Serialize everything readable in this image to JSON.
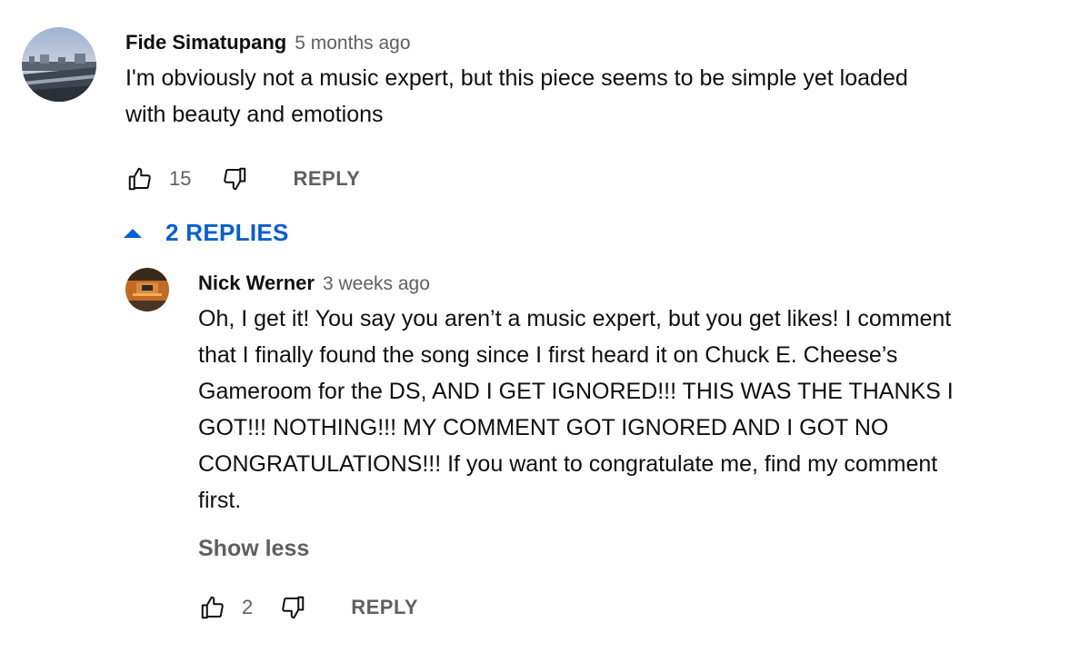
{
  "comment": {
    "author": "Fide Simatupang",
    "time": "5 months ago",
    "text_line1": "I'm obviously not a music expert, but this piece seems to be simple yet loaded",
    "text_line2": "with beauty and emotions",
    "like_count": "15",
    "reply_label": "REPLY",
    "avatar_icon": "landscape-avatar-icon"
  },
  "replies_toggle": {
    "label": "2 REPLIES",
    "icon": "caret-up-icon",
    "color": "#065fd4"
  },
  "reply": {
    "author": "Nick Werner",
    "time": "3 weeks ago",
    "lines": [
      "Oh, I get it! You say you aren’t a music expert, but you get likes! I comment",
      "that I finally found the song since I first heard it on Chuck E. Cheese’s",
      "Gameroom for the DS, AND I GET IGNORED!!! THIS WAS THE THANKS I",
      "GOT!!! NOTHING!!! MY COMMENT GOT IGNORED AND I GOT NO",
      "CONGRATULATIONS!!! If you want to congratulate me, find my comment",
      "first."
    ],
    "show_less_label": "Show less",
    "like_count": "2",
    "reply_label": "REPLY",
    "avatar_icon": "orange-avatar-icon"
  }
}
